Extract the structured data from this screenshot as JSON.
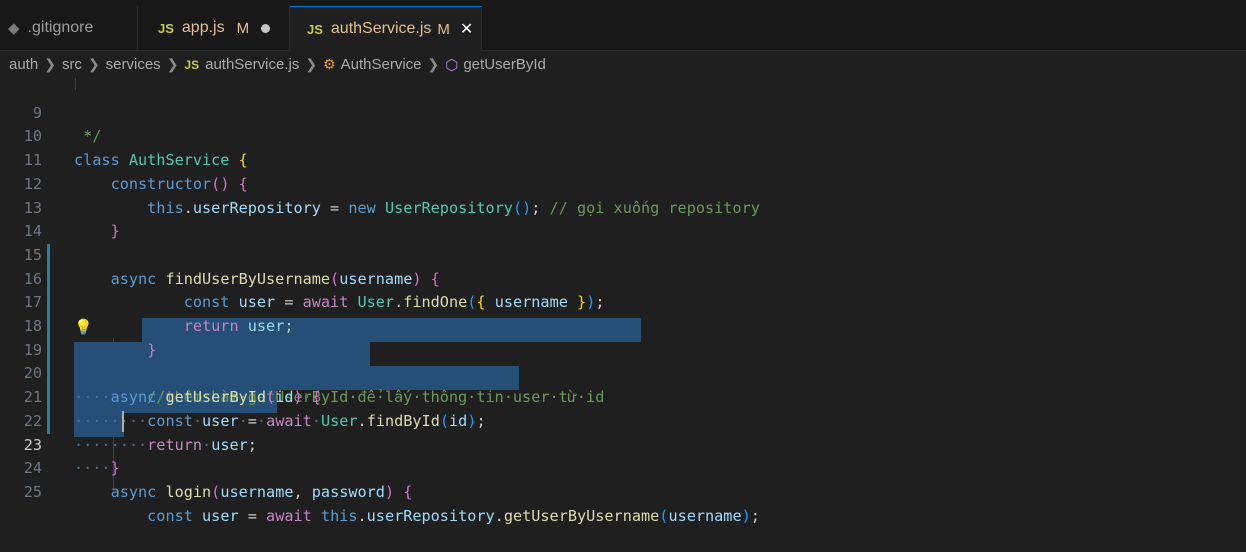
{
  "tabs": [
    {
      "label": ".gitignore",
      "icon": "gear-icon",
      "active": false
    },
    {
      "label": "app.js",
      "badge": "JS",
      "status": "M",
      "dirty": true,
      "active": false
    },
    {
      "label": "authService.js",
      "badge": "JS",
      "status": "M",
      "active": true
    }
  ],
  "breadcrumb": {
    "items": [
      "auth",
      "src",
      "services",
      "authService.js",
      "AuthService",
      "getUserById"
    ],
    "file_badge": "JS"
  },
  "editor": {
    "line_numbers": [
      "9",
      "10",
      "11",
      "12",
      "13",
      "14",
      "15",
      "16",
      "17",
      "18",
      "19",
      "20",
      "21",
      "22",
      "23",
      "24",
      "25"
    ],
    "current_line": "23",
    "lines": {
      "l9": " */",
      "l10_kw": "class",
      "l10_name": "AuthService",
      "l11_fn": "constructor",
      "l12_this": "this",
      "l12_prop": "userRepository",
      "l12_new": "new",
      "l12_cls": "UserRepository",
      "l12_comment": "// gọi xuống repository",
      "l15_async": "async",
      "l15_fn": "findUserByUsername",
      "l15_param": "username",
      "l16_const": "const",
      "l16_var": "user",
      "l16_await": "await",
      "l16_cls": "User",
      "l16_fn": "findOne",
      "l16_arg": "username",
      "l17_return": "return",
      "l17_var": "user",
      "l19_comment": "//thêm·hàm·getUserById·để·lấy·thông·tin·user·từ·id",
      "l20_async": "async",
      "l20_fn": "getUserById",
      "l20_param": "id",
      "l21_const": "const",
      "l21_var": "user",
      "l21_await": "await",
      "l21_cls": "User",
      "l21_fn": "findById",
      "l21_arg": "id",
      "l22_return": "return",
      "l22_var": "user",
      "l24_async": "async",
      "l24_fn": "login",
      "l24_p1": "username",
      "l24_p2": "password",
      "l25_const": "const",
      "l25_var": "user",
      "l25_await": "await",
      "l25_this": "this",
      "l25_prop": "userRepository",
      "l25_fn": "getUserByUsername",
      "l25_arg": "username"
    }
  },
  "colors": {
    "keyword": "#569cd6",
    "control": "#c586c0",
    "class": "#4ec9b0",
    "function": "#dcdcaa",
    "variable": "#9cdcfe",
    "comment": "#6a9955",
    "selection": "#264f78"
  }
}
